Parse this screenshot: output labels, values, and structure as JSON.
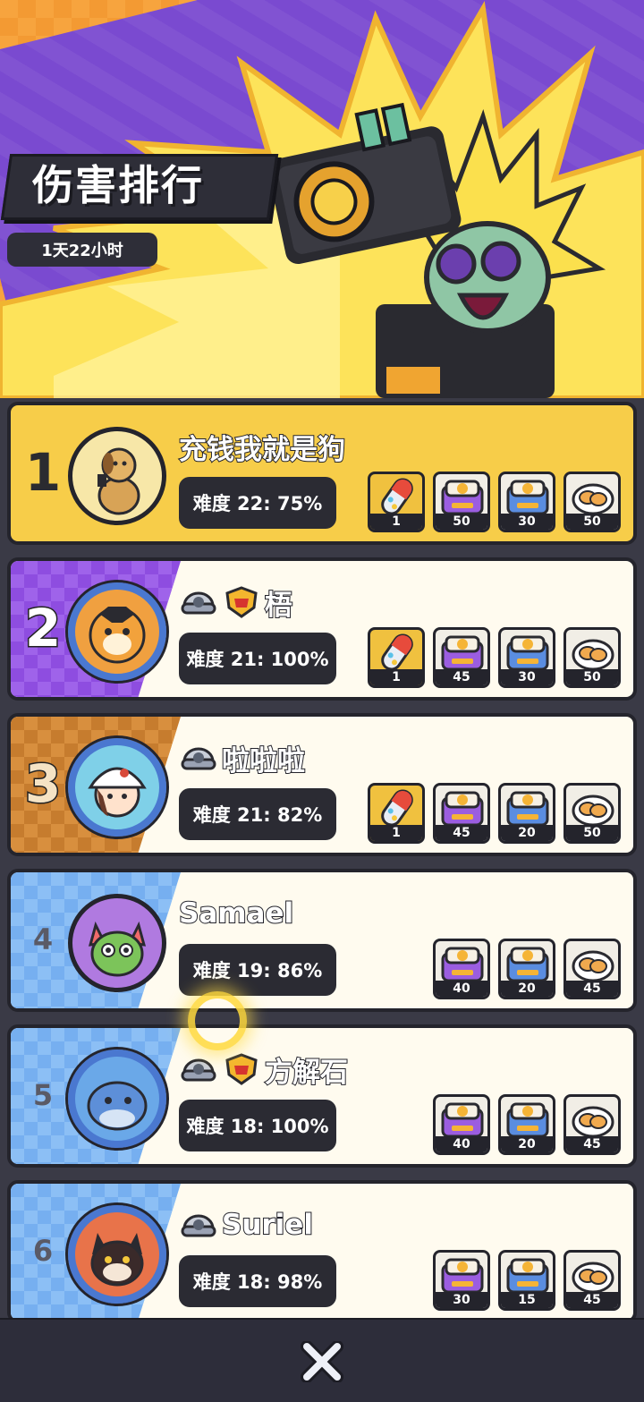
{
  "header": {
    "title": "伤害排行",
    "timer": "1天22小时"
  },
  "leaderboard": [
    {
      "rank": "1",
      "name": "充钱我就是狗",
      "difficulty": "难度 22: 75%",
      "rewards": [
        {
          "icon": "capsule-icon",
          "qty": "1"
        },
        {
          "icon": "purple-chest-icon",
          "qty": "50"
        },
        {
          "icon": "blue-chest-icon",
          "qty": "30"
        },
        {
          "icon": "bread-plate-icon",
          "qty": "50"
        }
      ]
    },
    {
      "rank": "2",
      "name": "梧",
      "difficulty": "难度 21: 100%",
      "rewards": [
        {
          "icon": "capsule-icon",
          "qty": "1"
        },
        {
          "icon": "purple-chest-icon",
          "qty": "45"
        },
        {
          "icon": "blue-chest-icon",
          "qty": "30"
        },
        {
          "icon": "bread-plate-icon",
          "qty": "50"
        }
      ]
    },
    {
      "rank": "3",
      "name": "啦啦啦",
      "difficulty": "难度 21: 82%",
      "rewards": [
        {
          "icon": "capsule-icon",
          "qty": "1"
        },
        {
          "icon": "purple-chest-icon",
          "qty": "45"
        },
        {
          "icon": "blue-chest-icon",
          "qty": "20"
        },
        {
          "icon": "bread-plate-icon",
          "qty": "50"
        }
      ]
    },
    {
      "rank": "4",
      "name": "Samael",
      "difficulty": "难度 19: 86%",
      "rewards": [
        {
          "icon": "purple-chest-icon",
          "qty": "40"
        },
        {
          "icon": "blue-chest-icon",
          "qty": "20"
        },
        {
          "icon": "bread-plate-icon",
          "qty": "45"
        }
      ]
    },
    {
      "rank": "5",
      "name": "方解石",
      "difficulty": "难度 18: 100%",
      "rewards": [
        {
          "icon": "purple-chest-icon",
          "qty": "40"
        },
        {
          "icon": "blue-chest-icon",
          "qty": "20"
        },
        {
          "icon": "bread-plate-icon",
          "qty": "45"
        }
      ]
    },
    {
      "rank": "6",
      "name": "Suriel",
      "difficulty": "难度 18: 98%",
      "rewards": [
        {
          "icon": "purple-chest-icon",
          "qty": "30"
        },
        {
          "icon": "blue-chest-icon",
          "qty": "15"
        },
        {
          "icon": "bread-plate-icon",
          "qty": "45"
        }
      ]
    }
  ],
  "bottom": {
    "close_icon": "close-icon"
  },
  "colors": {
    "gold_row": "#f7cd49",
    "row_bg": "#fffbef",
    "dark": "#24242c",
    "accent_purple": "#8e4de0"
  }
}
